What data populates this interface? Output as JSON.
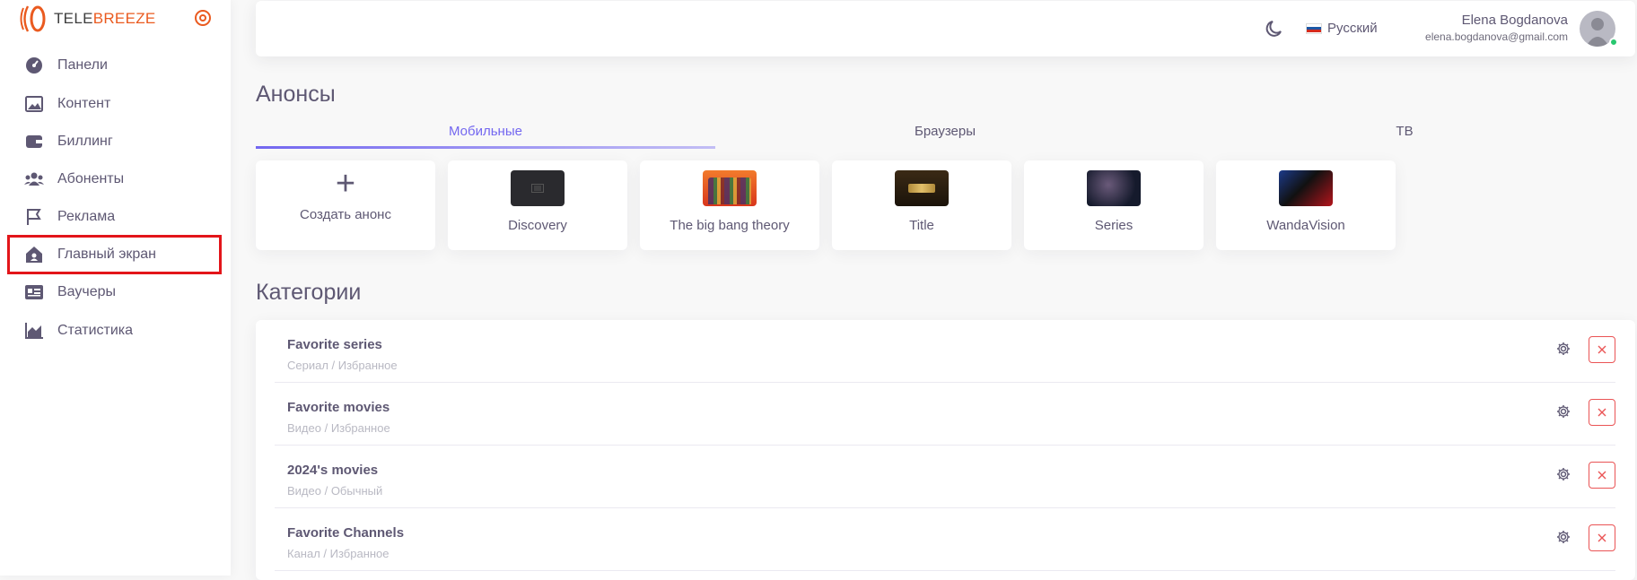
{
  "brand": {
    "prefix": "TELE",
    "suffix": "BREEZE"
  },
  "sidebar": {
    "items": [
      {
        "label": "Панели",
        "icon": "dashboard-icon"
      },
      {
        "label": "Контент",
        "icon": "image-icon"
      },
      {
        "label": "Биллинг",
        "icon": "wallet-icon"
      },
      {
        "label": "Абоненты",
        "icon": "users-icon"
      },
      {
        "label": "Реклама",
        "icon": "flag-icon"
      },
      {
        "label": "Главный экран",
        "icon": "home-icon"
      },
      {
        "label": "Ваучеры",
        "icon": "voucher-icon"
      },
      {
        "label": "Статистика",
        "icon": "chart-icon"
      }
    ]
  },
  "header": {
    "language": "Русский",
    "user_name": "Elena Bogdanova",
    "user_email": "elena.bogdanova@gmail.com"
  },
  "announcements": {
    "title": "Анонсы",
    "tabs": [
      {
        "label": "Мобильные"
      },
      {
        "label": "Браузеры"
      },
      {
        "label": "ТВ"
      }
    ],
    "create_label": "Создать анонс",
    "cards": [
      {
        "title": "Discovery"
      },
      {
        "title": "The big bang theory"
      },
      {
        "title": "Title"
      },
      {
        "title": "Series"
      },
      {
        "title": "WandaVision"
      }
    ]
  },
  "categories": {
    "title": "Категории",
    "rows": [
      {
        "name": "Favorite series",
        "sub": "Сериал / Избранное"
      },
      {
        "name": "Favorite movies",
        "sub": "Видео / Избранное"
      },
      {
        "name": "2024's movies",
        "sub": "Видео / Обычный"
      },
      {
        "name": "Favorite Channels",
        "sub": "Канал / Избранное"
      }
    ]
  },
  "colors": {
    "accent": "#7367f0",
    "brand": "#ea5a1f",
    "danger": "#ea5455",
    "highlight": "#e3151a"
  }
}
